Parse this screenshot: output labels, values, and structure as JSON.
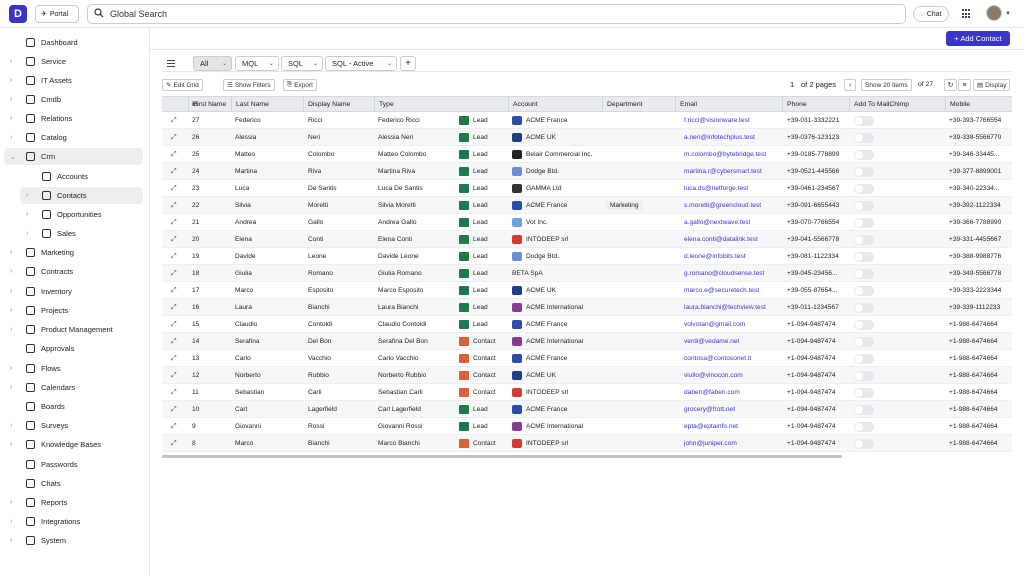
{
  "topbar": {
    "logo": "D",
    "portal_label": "Portal",
    "search_placeholder": "Global Search",
    "chat_label": "Chat"
  },
  "sidebar": {
    "items": [
      {
        "label": "Dashboard",
        "icon": "dashboard-icon",
        "chevron": false,
        "indent": 0
      },
      {
        "label": "Service",
        "icon": "megaphone-icon",
        "chevron": true,
        "indent": 0
      },
      {
        "label": "IT Assets",
        "icon": "building-icon",
        "chevron": true,
        "indent": 0
      },
      {
        "label": "Cmdb",
        "icon": "database-icon",
        "chevron": true,
        "indent": 0
      },
      {
        "label": "Relations",
        "icon": "relations-icon",
        "chevron": true,
        "indent": 0
      },
      {
        "label": "Catalog",
        "icon": "catalog-icon",
        "chevron": true,
        "indent": 0
      },
      {
        "label": "Crm",
        "icon": "crm-icon",
        "chevron": true,
        "indent": 0,
        "expanded": true,
        "active": true
      },
      {
        "label": "Accounts",
        "icon": "accounts-icon",
        "chevron": false,
        "indent": 1
      },
      {
        "label": "Contacts",
        "icon": "contacts-icon",
        "chevron": true,
        "indent": 1,
        "active": true
      },
      {
        "label": "Opportunities",
        "icon": "opportunities-icon",
        "chevron": true,
        "indent": 1
      },
      {
        "label": "Sales",
        "icon": "sales-icon",
        "chevron": true,
        "indent": 1
      },
      {
        "label": "Marketing",
        "icon": "marketing-icon",
        "chevron": true,
        "indent": 0
      },
      {
        "label": "Contracts",
        "icon": "contracts-icon",
        "chevron": true,
        "indent": 0
      },
      {
        "label": "Inventory",
        "icon": "inventory-icon",
        "chevron": true,
        "indent": 0
      },
      {
        "label": "Projects",
        "icon": "projects-icon",
        "chevron": true,
        "indent": 0
      },
      {
        "label": "Product Management",
        "icon": "product-icon",
        "chevron": true,
        "indent": 0
      },
      {
        "label": "Approvals",
        "icon": "approvals-icon",
        "chevron": false,
        "indent": 0
      },
      {
        "label": "Flows",
        "icon": "flows-icon",
        "chevron": true,
        "indent": 0
      },
      {
        "label": "Calendars",
        "icon": "calendar-icon",
        "chevron": true,
        "indent": 0
      },
      {
        "label": "Boards",
        "icon": "boards-icon",
        "chevron": false,
        "indent": 0
      },
      {
        "label": "Surveys",
        "icon": "surveys-icon",
        "chevron": true,
        "indent": 0
      },
      {
        "label": "Knowledge Bases",
        "icon": "knowledge-icon",
        "chevron": true,
        "indent": 0
      },
      {
        "label": "Passwords",
        "icon": "key-icon",
        "chevron": false,
        "indent": 0
      },
      {
        "label": "Chats",
        "icon": "chat-icon",
        "chevron": false,
        "indent": 0
      },
      {
        "label": "Reports",
        "icon": "reports-icon",
        "chevron": true,
        "indent": 0
      },
      {
        "label": "Integrations",
        "icon": "integrations-icon",
        "chevron": true,
        "indent": 0
      },
      {
        "label": "System",
        "icon": "system-icon",
        "chevron": true,
        "indent": 0
      }
    ]
  },
  "header": {
    "add_contact_label": "+ Add Contact"
  },
  "tabs": [
    {
      "label": "All",
      "active": true
    },
    {
      "label": "MQL",
      "active": false
    },
    {
      "label": "SQL",
      "active": false
    },
    {
      "label": "SQL - Active",
      "active": false
    }
  ],
  "toolbar": {
    "edit_grid": "Edit Grid",
    "show_filters": "Show Filters",
    "export": "Export",
    "page_current": "1",
    "page_of": "of 2 pages",
    "show_items": "Show 20 items",
    "total": "of 27",
    "display": "Display"
  },
  "table": {
    "columns": [
      "Id",
      "First Name",
      "Last Name",
      "Display Name",
      "Type",
      "Account",
      "Department",
      "Email",
      "Phone",
      "Add To MailChimp",
      "Mobile"
    ],
    "rows": [
      {
        "id": "27",
        "first": "Federico",
        "last": "Ricci",
        "display": "Federico Ricci",
        "type": "Lead",
        "account": "ACME France",
        "acct_color": "#2b4fa8",
        "department": "",
        "email": "f.ricci@visionware.test",
        "phone": "+39-031-3332221",
        "mobile": "+39-393-7766554"
      },
      {
        "id": "26",
        "first": "Alessia",
        "last": "Neri",
        "display": "Alessia Neri",
        "type": "Lead",
        "account": "ACME UK",
        "acct_color": "#1f3e8a",
        "department": "",
        "email": "a.neri@infotechplus.test",
        "phone": "+39-0376-123123",
        "mobile": "+39-338-5566770"
      },
      {
        "id": "25",
        "first": "Matteo",
        "last": "Colombo",
        "display": "Matteo Colombo",
        "type": "Lead",
        "account": "Belair Commercial Inc.",
        "acct_color": "#222222",
        "department": "",
        "email": "m.colombo@bytebridge.test",
        "phone": "+39-0185-778899",
        "mobile": "+39-346-33445..."
      },
      {
        "id": "24",
        "first": "Martina",
        "last": "Riva",
        "display": "Martina Riva",
        "type": "Lead",
        "account": "Dodge Btd.",
        "acct_color": "#6a8fd6",
        "department": "",
        "email": "martina.r@cybersmart.test",
        "phone": "+39-0521-445566",
        "mobile": "+39-377-8899001"
      },
      {
        "id": "23",
        "first": "Luca",
        "last": "De Santis",
        "display": "Luca De Santis",
        "type": "Lead",
        "account": "GAMMA Ltd",
        "acct_color": "#333333",
        "department": "",
        "email": "luca.ds@netforge.test",
        "phone": "+39-0461-234567",
        "mobile": "+39-340-22334..."
      },
      {
        "id": "22",
        "first": "Silvia",
        "last": "Moretti",
        "display": "Silvia Moretti",
        "type": "Lead",
        "account": "ACME France",
        "acct_color": "#2b4fa8",
        "department": "Marketing",
        "email": "s.moretti@greencloud.test",
        "phone": "+39-091-6655443",
        "mobile": "+39-392-1122334"
      },
      {
        "id": "21",
        "first": "Andrea",
        "last": "Gallo",
        "display": "Andrea Gallo",
        "type": "Lead",
        "account": "Vot Inc.",
        "acct_color": "#6aa5d8",
        "department": "",
        "email": "a.gallo@nextwave.test",
        "phone": "+39-070-7766554",
        "mobile": "+39-366-7788990"
      },
      {
        "id": "20",
        "first": "Elena",
        "last": "Conti",
        "display": "Elena Conti",
        "type": "Lead",
        "account": "INTODEEP srl",
        "acct_color": "#d63b2f",
        "department": "",
        "email": "elena.conti@datalink.test",
        "phone": "+39-041-5566778",
        "mobile": "+39-331-4455667"
      },
      {
        "id": "19",
        "first": "Davide",
        "last": "Leone",
        "display": "Davide Leone",
        "type": "Lead",
        "account": "Dodge Btd.",
        "acct_color": "#6a8fd6",
        "department": "",
        "email": "d.leone@infobits.test",
        "phone": "+39-081-1122334",
        "mobile": "+39-388-9988776"
      },
      {
        "id": "18",
        "first": "Giulia",
        "last": "Romano",
        "display": "Giulia Romano",
        "type": "Lead",
        "account": "BETA SpA",
        "acct_color": "",
        "department": "",
        "email": "g.romano@cloudsense.test",
        "phone": "+39-045-23456...",
        "mobile": "+39-349-5566778"
      },
      {
        "id": "17",
        "first": "Marco",
        "last": "Esposito",
        "display": "Marco Esposito",
        "type": "Lead",
        "account": "ACME UK",
        "acct_color": "#1f3e8a",
        "department": "",
        "email": "marco.e@securetech.test",
        "phone": "+39-055-87654...",
        "mobile": "+39-333-2223344"
      },
      {
        "id": "16",
        "first": "Laura",
        "last": "Bianchi",
        "display": "Laura Bianchi",
        "type": "Lead",
        "account": "ACME International",
        "acct_color": "#8a3b8f",
        "department": "",
        "email": "laura.bianchi@techview.test",
        "phone": "+39-011-1234567",
        "mobile": "+39-339-1112233"
      },
      {
        "id": "15",
        "first": "Claudio",
        "last": "Contoldi",
        "display": "Claudio Contoldi",
        "type": "Lead",
        "account": "ACME France",
        "acct_color": "#2b4fa8",
        "department": "",
        "email": "volvotan@gmail.com",
        "phone": "+1-094-9487474",
        "mobile": "+1-988-6474664"
      },
      {
        "id": "14",
        "first": "Serafina",
        "last": "Del Bon",
        "display": "Serafina Del Bon",
        "type": "Contact",
        "account": "ACME International",
        "acct_color": "#8a3b8f",
        "department": "",
        "email": "verdi@vedame.net",
        "phone": "+1-094-9487474",
        "mobile": "+1-988-6474664"
      },
      {
        "id": "13",
        "first": "Carlo",
        "last": "Vacchio",
        "display": "Carlo Vacchio",
        "type": "Contact",
        "account": "ACME France",
        "acct_color": "#2b4fa8",
        "department": "",
        "email": "contosa@contosonet.it",
        "phone": "+1-094-9487474",
        "mobile": "+1-988-6474664"
      },
      {
        "id": "12",
        "first": "Norberto",
        "last": "Rubbio",
        "display": "Norberto Rubbio",
        "type": "Contact",
        "account": "ACME UK",
        "acct_color": "#1f3e8a",
        "department": "",
        "email": "viullo@vinocon.com",
        "phone": "+1-094-9487474",
        "mobile": "+1-988-6474664"
      },
      {
        "id": "11",
        "first": "Sebastian",
        "last": "Carli",
        "display": "Sebastian Carli",
        "type": "Contact",
        "account": "INTODEEP srl",
        "acct_color": "#d63b2f",
        "department": "",
        "email": "daben@faben.com",
        "phone": "+1-094-9487474",
        "mobile": "+1-988-6474664"
      },
      {
        "id": "10",
        "first": "Carl",
        "last": "Lagerfield",
        "display": "Carl Lagerfield",
        "type": "Lead",
        "account": "ACME France",
        "acct_color": "#2b4fa8",
        "department": "",
        "email": "grocery@frott.net",
        "phone": "+1-094-9487474",
        "mobile": "+1-988-6474664"
      },
      {
        "id": "9",
        "first": "Giovanni",
        "last": "Rossi",
        "display": "Giovanni Rossi",
        "type": "Lead",
        "account": "ACME International",
        "acct_color": "#8a3b8f",
        "department": "",
        "email": "epta@eptainfo.net",
        "phone": "+1-094-9487474",
        "mobile": "+1-988-6474664"
      },
      {
        "id": "8",
        "first": "Marco",
        "last": "Bianchi",
        "display": "Marco Bianchi",
        "type": "Contact",
        "account": "INTODEEP srl",
        "acct_color": "#d63b2f",
        "department": "",
        "email": "john@juniper.com",
        "phone": "+1-094-9487474",
        "mobile": "+1-988-6474664"
      }
    ]
  }
}
